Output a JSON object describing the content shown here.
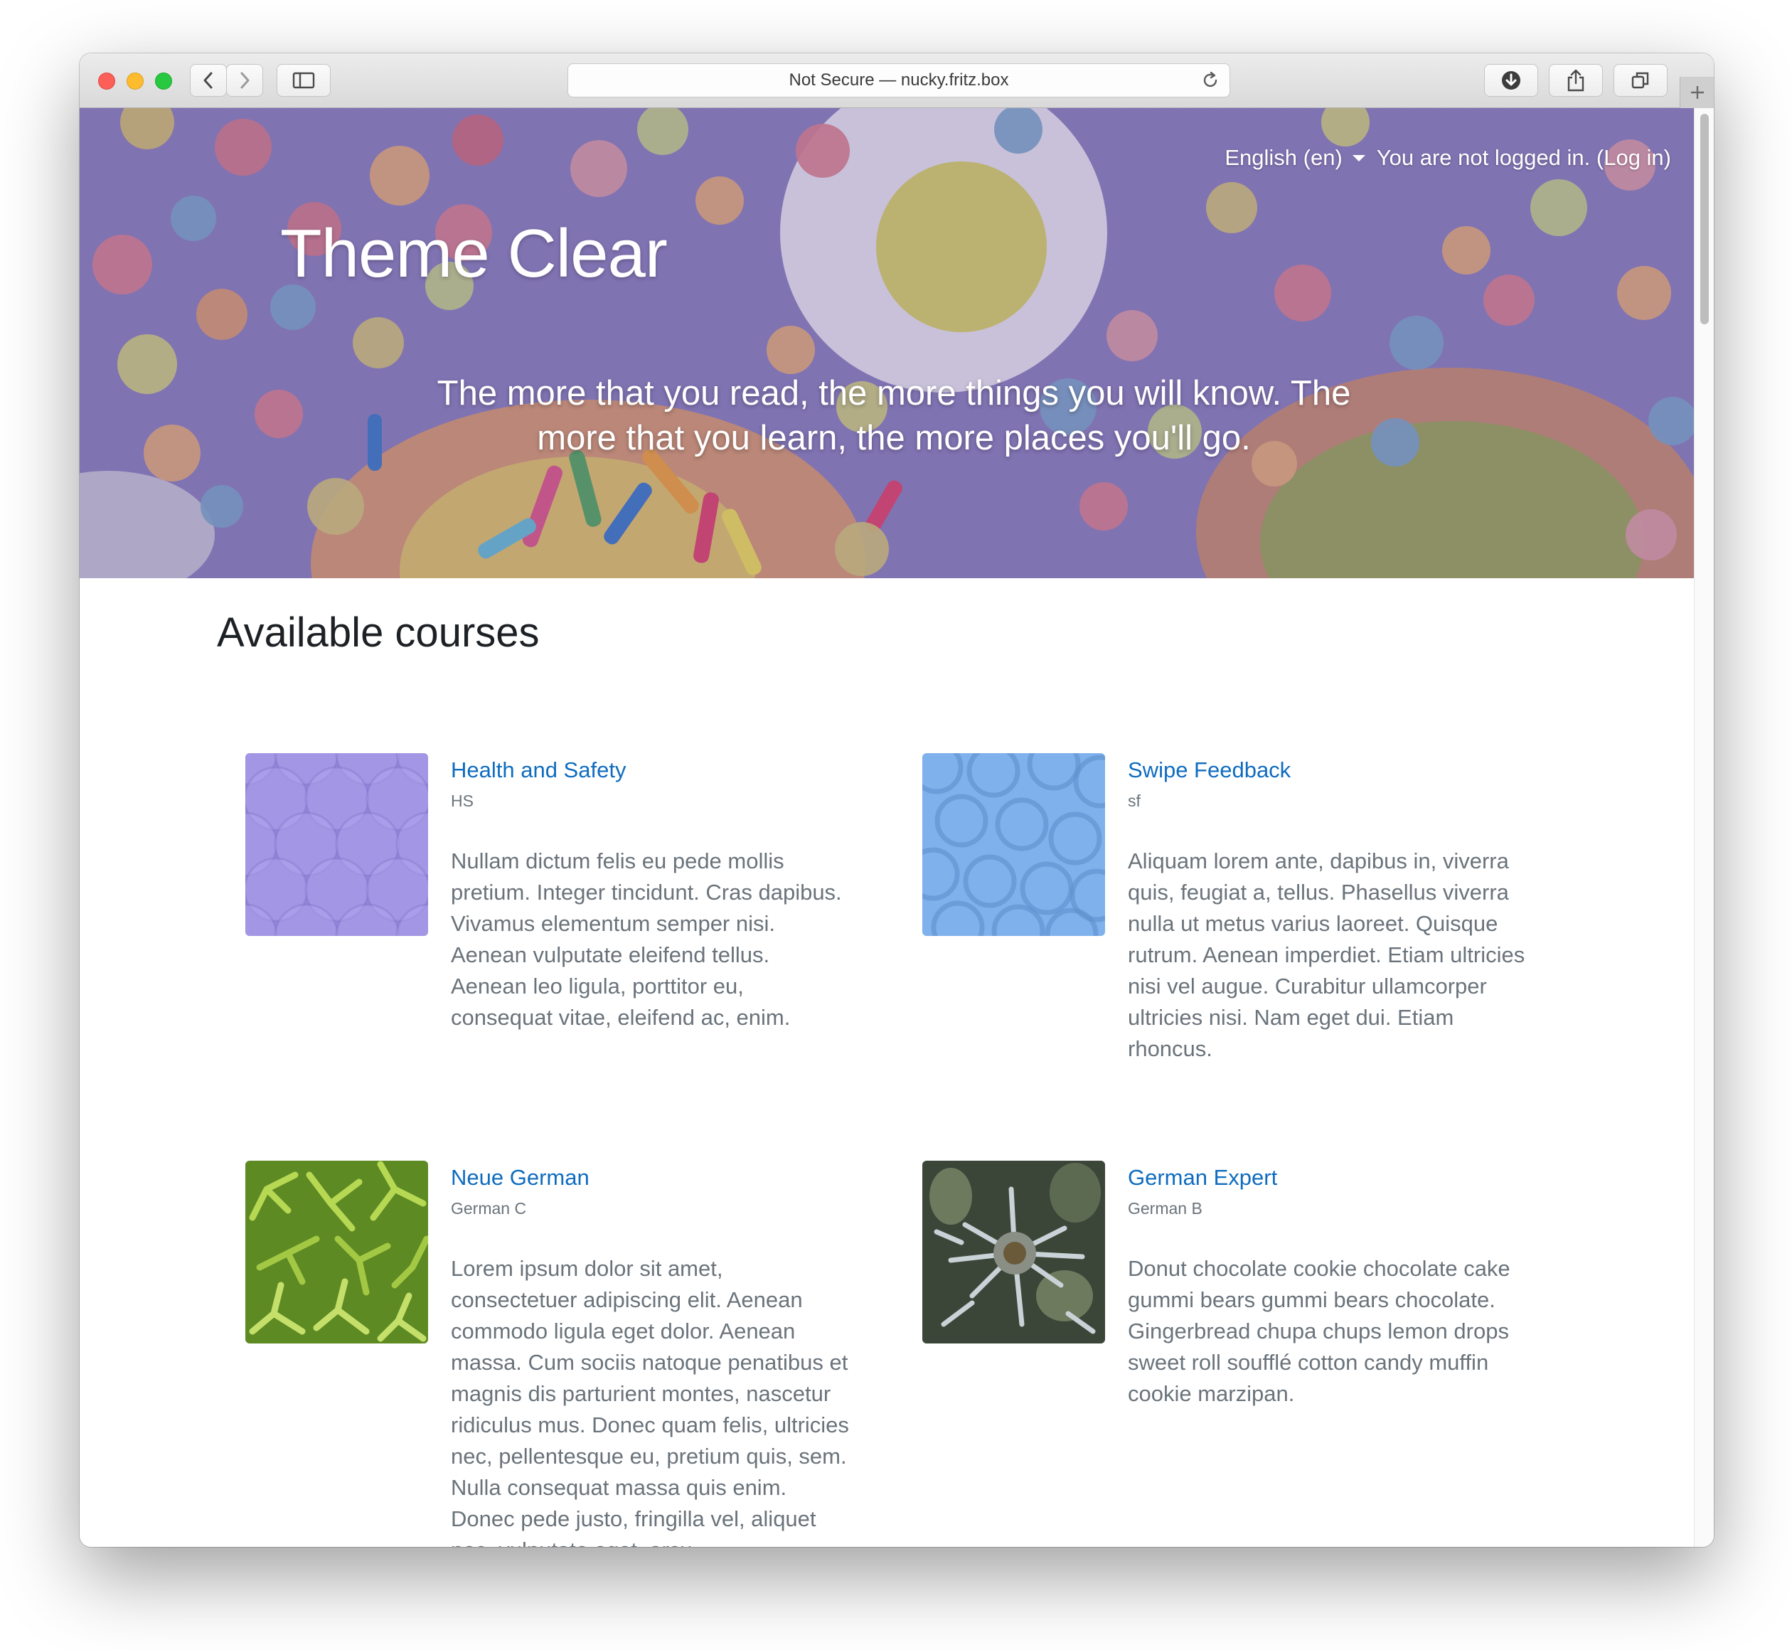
{
  "browser": {
    "url_text": "Not Secure — nucky.fritz.box"
  },
  "header": {
    "language": "English (en)",
    "login_text": "You are not logged in. (Log in)"
  },
  "hero": {
    "site_title": "Theme Clear",
    "tagline": "The more that you read, the more things you will know. The more that you learn, the more places you'll go."
  },
  "main": {
    "section_title": "Available courses",
    "courses": [
      {
        "name": "Health and Safety",
        "shortname": "HS",
        "summary": "Nullam dictum felis eu pede mollis pretium. Integer tincidunt. Cras dapibus. Vivamus elementum semper nisi. Aenean vulputate eleifend tellus. Aenean leo ligula, porttitor eu, consequat vitae, eleifend ac, enim.",
        "image": "purple-circle-pattern"
      },
      {
        "name": "Swipe Feedback",
        "shortname": "sf",
        "summary": "Aliquam lorem ante, dapibus in, viverra quis, feugiat a, tellus. Phasellus viverra nulla ut metus varius laoreet. Quisque rutrum. Aenean imperdiet. Etiam ultricies nisi vel augue. Curabitur ullamcorper ultricies nisi. Nam eget dui. Etiam rhoncus.",
        "image": "blue-ring-pattern"
      },
      {
        "name": "Neue German",
        "shortname": "German C",
        "summary": "Lorem ipsum dolor sit amet, consectetuer adipiscing elit. Aenean commodo ligula eget dolor. Aenean massa. Cum sociis natoque penatibus et magnis dis parturient montes, nascetur ridiculus mus. Donec quam felis, ultricies nec, pellentesque eu, pretium quis, sem. Nulla consequat massa quis enim. Donec pede justo, fringilla vel, aliquet nec, vulputate eget, arcu",
        "image": "green-plant-photo"
      },
      {
        "name": "German Expert",
        "shortname": "German B",
        "summary": "Donut chocolate cookie chocolate cake gummi bears gummi bears chocolate. Gingerbread chupa chups lemon drops sweet roll soufflé cotton candy muffin cookie marzipan.",
        "image": "thistle-flower-photo"
      }
    ]
  },
  "colors": {
    "link": "#0f6cbf",
    "muted_text": "#6a737b",
    "heading": "#1d2125",
    "hero_purple": "#8f83bf"
  }
}
